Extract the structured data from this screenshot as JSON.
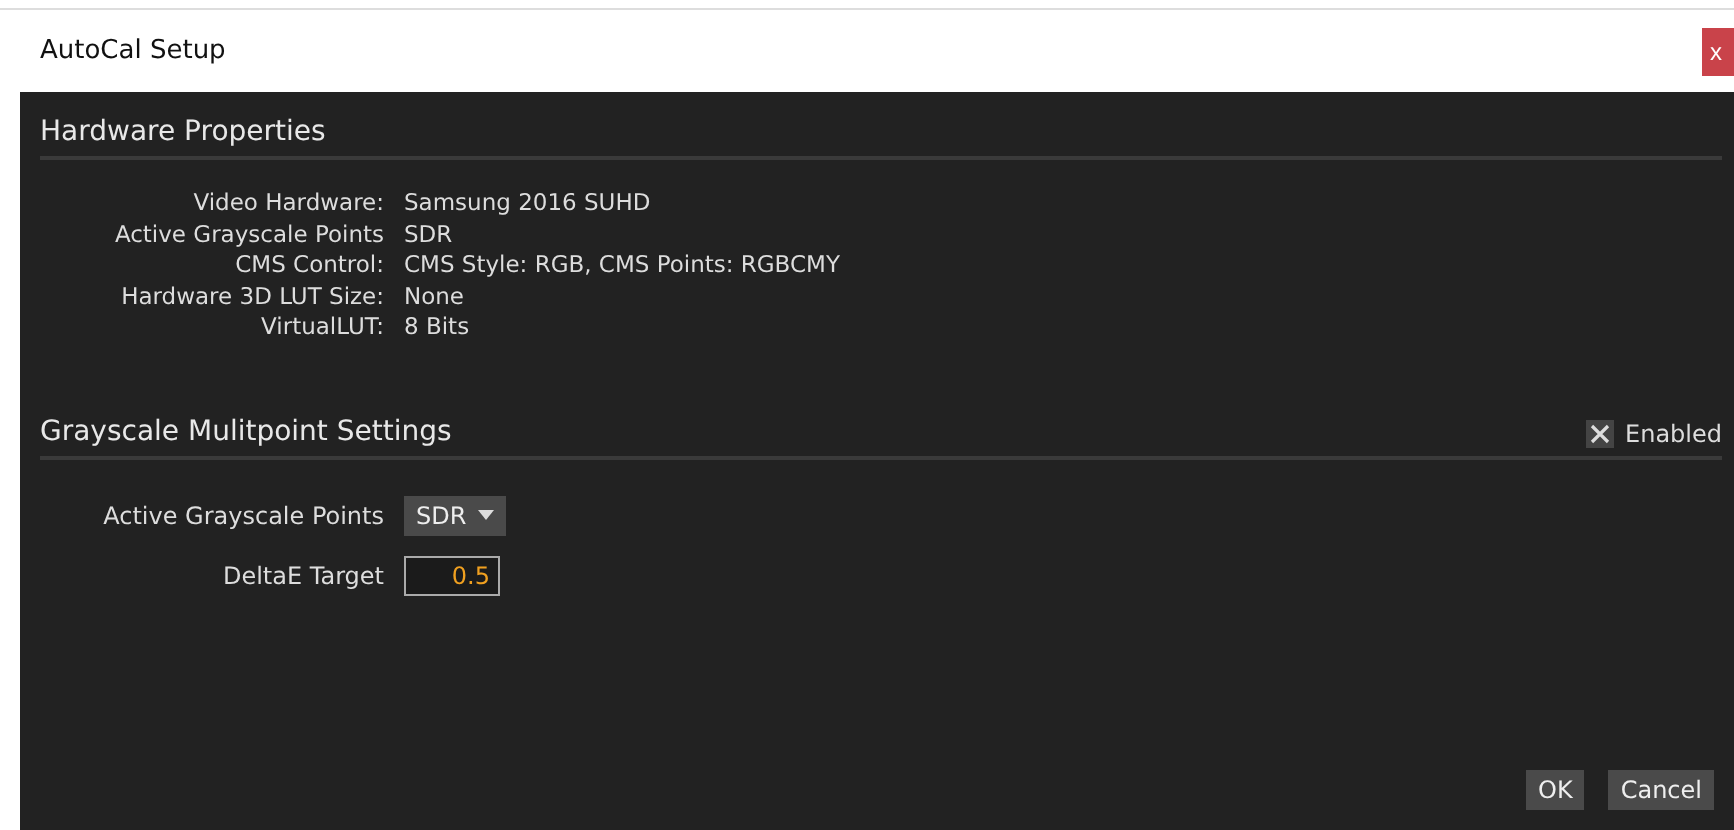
{
  "window": {
    "title": "AutoCal Setup",
    "close": "x"
  },
  "hardware": {
    "title": "Hardware Properties",
    "rows": [
      {
        "label": "Video Hardware:",
        "value": "Samsung 2016 SUHD"
      },
      {
        "label": "Active Grayscale Points",
        "value": "SDR"
      },
      {
        "label": "CMS Control:",
        "value": "CMS Style: RGB, CMS Points: RGBCMY"
      },
      {
        "label": "Hardware 3D LUT Size:",
        "value": "None"
      },
      {
        "label": "VirtualLUT:",
        "value": "8 Bits"
      }
    ]
  },
  "grayscale": {
    "title": "Grayscale Mulitpoint Settings",
    "enabled": {
      "label": "Enabled",
      "checked": true
    },
    "points": {
      "label": "Active Grayscale Points",
      "value": "SDR"
    },
    "delta": {
      "label": "DeltaE Target",
      "value": "0.5"
    }
  },
  "buttons": [
    "OK",
    "Cancel"
  ]
}
